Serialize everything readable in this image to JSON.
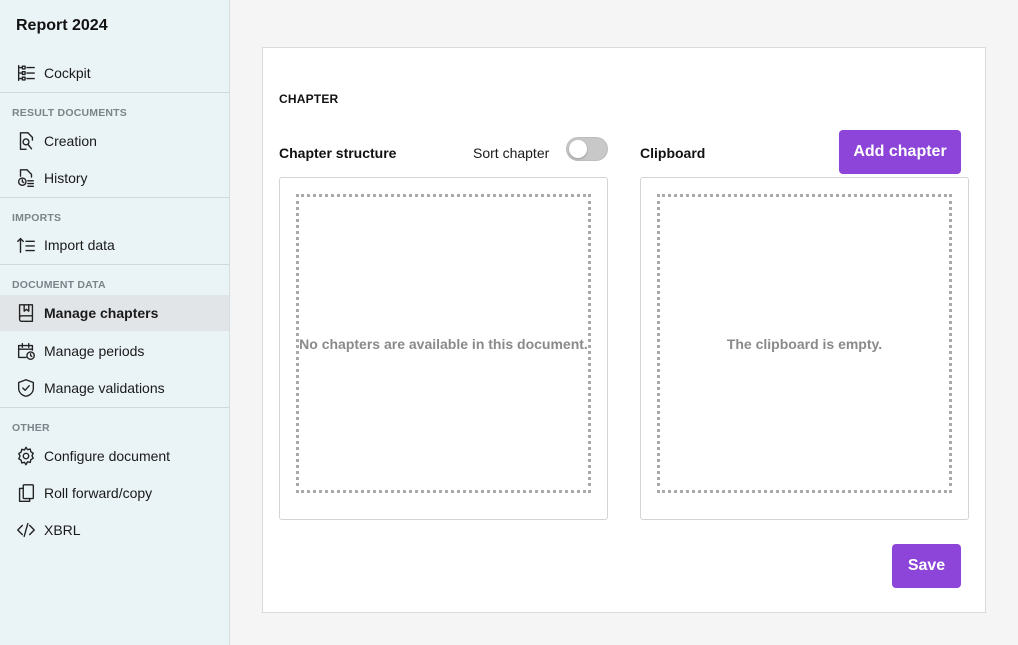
{
  "sidebar": {
    "title": "Report 2024",
    "cockpit": "Cockpit",
    "sections": {
      "result_documents": "RESULT DOCUMENTS",
      "imports": "IMPORTS",
      "document_data": "DOCUMENT DATA",
      "other": "OTHER"
    },
    "items": {
      "creation": "Creation",
      "history": "History",
      "import_data": "Import data",
      "manage_chapters": "Manage chapters",
      "manage_periods": "Manage periods",
      "manage_validations": "Manage validations",
      "configure_document": "Configure document",
      "roll_forward": "Roll forward/copy",
      "xbrl": "XBRL"
    },
    "active_item": "manage_chapters"
  },
  "main": {
    "heading": "CHAPTER",
    "chapter_structure": {
      "title": "Chapter structure",
      "sort_label": "Sort chapter",
      "sort_enabled": false,
      "empty_text": "No chapters are available in this document."
    },
    "clipboard": {
      "title": "Clipboard",
      "add_button": "Add chapter",
      "empty_text": "The clipboard is empty."
    },
    "save_button": "Save"
  },
  "colors": {
    "accent": "#8c44d9",
    "sidebar_bg": "#eaf3f6",
    "active_item_bg": "#e2e5e7"
  }
}
